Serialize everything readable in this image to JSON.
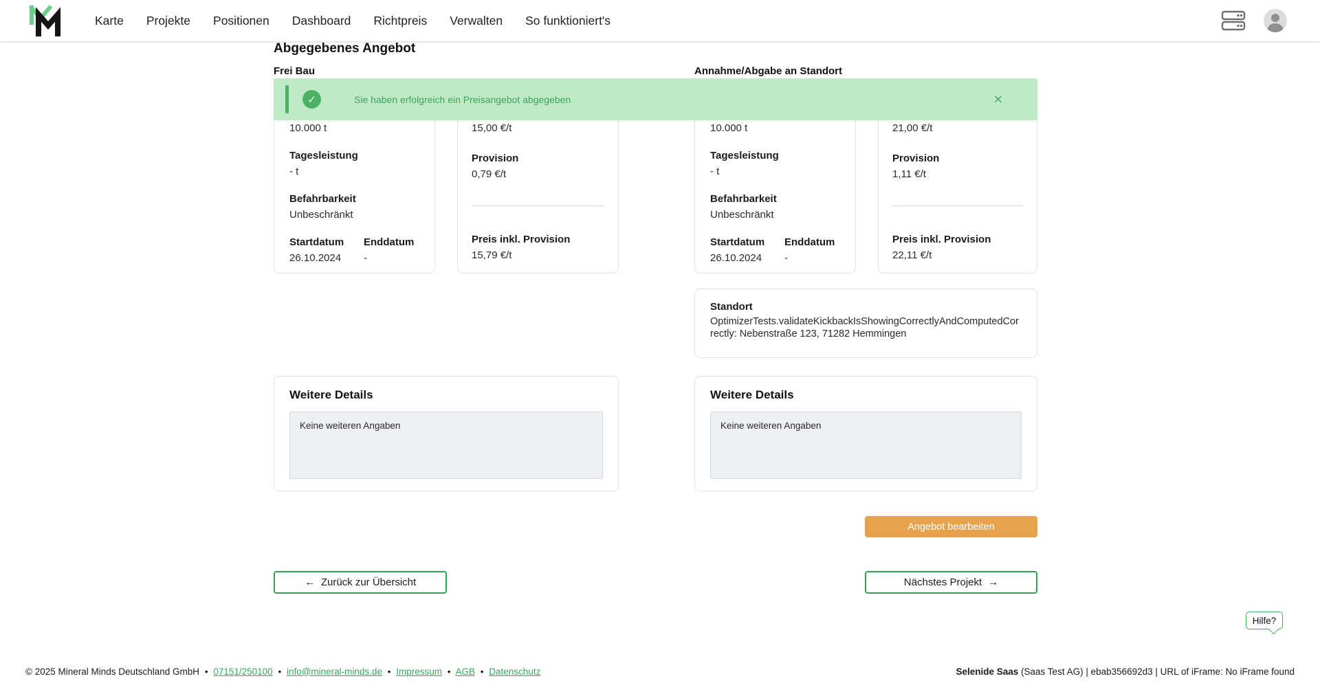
{
  "nav": {
    "items": [
      "Karte",
      "Projekte",
      "Positionen",
      "Dashboard",
      "Richtpreis",
      "Verwalten",
      "So funktioniert's"
    ]
  },
  "page": {
    "title": "Abgegebenes Angebot"
  },
  "toast": {
    "message": "Sie haben erfolgreich ein Preisangebot abgegeben",
    "check_glyph": "✓",
    "close_glyph": "✕",
    "bg_color": "#bfeac5",
    "accent_color": "#4cb166",
    "text_color": "#3da45b"
  },
  "sections": {
    "left": {
      "heading": "Frei Bau",
      "details": {
        "quantity": "10.000 t",
        "daily_output_label": "Tagesleistung",
        "daily_output": "- t",
        "trafficability_label": "Befahrbarkeit",
        "trafficability": "Unbeschränkt",
        "start_date_label": "Startdatum",
        "start_date": "26.10.2024",
        "end_date_label": "Enddatum",
        "end_date": "-"
      },
      "price": {
        "offer_price": "15,00 €/t",
        "commission_label": "Provision",
        "commission": "0,79 €/t",
        "total_label": "Preis inkl. Provision",
        "total": "15,79 €/t"
      },
      "more_details": {
        "heading": "Weitere Details",
        "text": "Keine weiteren Angaben"
      }
    },
    "right": {
      "heading": "Annahme/Abgabe an Standort",
      "details": {
        "quantity": "10.000 t",
        "daily_output_label": "Tagesleistung",
        "daily_output": "- t",
        "trafficability_label": "Befahrbarkeit",
        "trafficability": "Unbeschränkt",
        "start_date_label": "Startdatum",
        "start_date": "26.10.2024",
        "end_date_label": "Enddatum",
        "end_date": "-"
      },
      "price": {
        "offer_price": "21,00 €/t",
        "commission_label": "Provision",
        "commission": "1,11 €/t",
        "total_label": "Preis inkl. Provision",
        "total": "22,11 €/t"
      },
      "location": {
        "label": "Standort",
        "value": "OptimizerTests.validateKickbackIsShowingCorrectlyAndComputedCorrectly: Nebenstraße 123, 71282 Hemmingen"
      },
      "more_details": {
        "heading": "Weitere Details",
        "text": "Keine weiteren Angaben"
      }
    }
  },
  "actions": {
    "edit_offer": "Angebot bearbeiten",
    "edit_color": "#e9a24c",
    "back_arrow": "←",
    "back_label": "Zurück zur Übersicht",
    "next_label": "Nächstes Projekt",
    "next_arrow": "→",
    "outline_border_color": "#2ea255"
  },
  "help": {
    "label": "Hilfe?"
  },
  "footer": {
    "copyright": "© 2025 Mineral Minds Deutschland GmbH",
    "separator": "•",
    "phone": "07151/250100",
    "email": "info@mineral-minds.de",
    "imprint": "Impressum",
    "terms": "AGB",
    "privacy": "Datenschutz",
    "right_bold": "Selenide Saas",
    "right_rest": " (Saas Test AG) | ebab356692d3 | URL of iFrame: No iFrame found"
  },
  "icons": {
    "logo": "mineral-minds-logo",
    "dns": "dns-icon",
    "avatar": "user-avatar-icon",
    "link_green": "#3aa55d"
  }
}
